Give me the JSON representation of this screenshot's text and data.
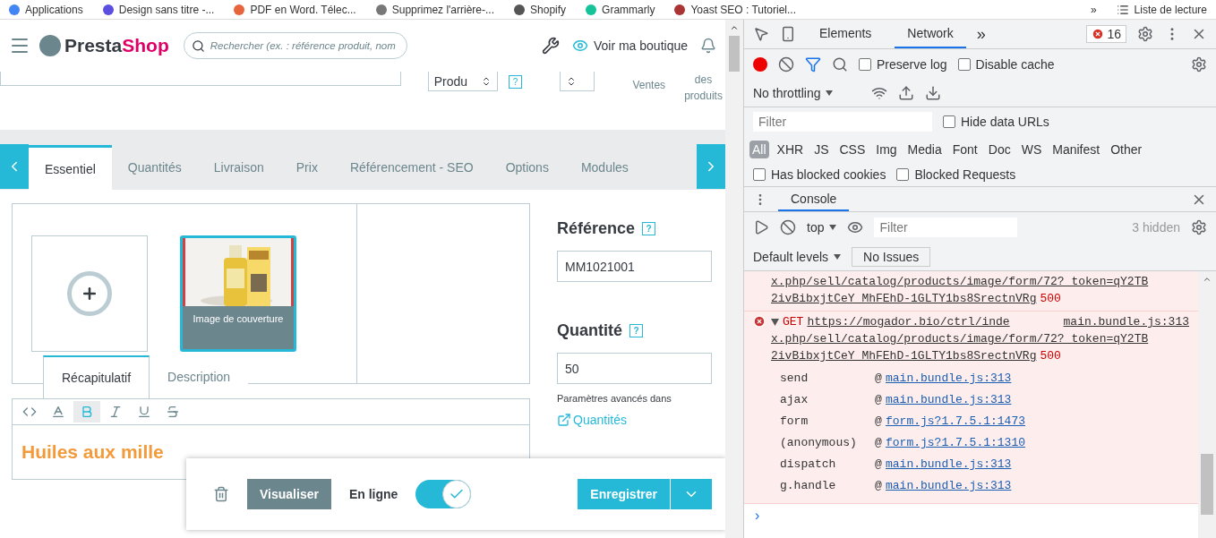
{
  "bookmarks": [
    {
      "label": "Applications"
    },
    {
      "label": "Design sans titre -..."
    },
    {
      "label": "PDF en Word. Télec..."
    },
    {
      "label": "Supprimez l'arrière-..."
    },
    {
      "label": "Shopify"
    },
    {
      "label": "Grammarly"
    },
    {
      "label": "Yoast SEO : Tutoriel..."
    }
  ],
  "bookmarks_more": "»",
  "reading_list": "Liste de lecture",
  "header": {
    "logo_a": "Presta",
    "logo_b": "Shop",
    "search_placeholder": "Rechercher (ex. : référence produit, nom",
    "view_shop": "Voir ma boutique"
  },
  "product_bar": {
    "type_select": "Produ",
    "help": "?",
    "ventes": "Ventes",
    "products_list": "des produits"
  },
  "tabs": [
    {
      "label": "Essentiel",
      "selected": true
    },
    {
      "label": "Quantités",
      "selected": false
    },
    {
      "label": "Livraison",
      "selected": false
    },
    {
      "label": "Prix",
      "selected": false
    },
    {
      "label": "Référencement - SEO",
      "selected": false
    },
    {
      "label": "Options",
      "selected": false
    },
    {
      "label": "Modules",
      "selected": false
    }
  ],
  "images": {
    "cover_caption": "Image de couverture"
  },
  "reference": {
    "label": "Référence",
    "help": "?",
    "value": "MM1021001"
  },
  "quantity": {
    "label": "Quantité",
    "help": "?",
    "value": "50",
    "hint": "Paramètres avancés dans",
    "link": "Quantités"
  },
  "editor_tabs": [
    {
      "label": "Récapitulatif",
      "selected": true
    },
    {
      "label": "Description",
      "selected": false
    }
  ],
  "editor_tools": [
    {
      "kind": "code",
      "selected": false
    },
    {
      "kind": "color",
      "selected": false
    },
    {
      "kind": "bold",
      "selected": true
    },
    {
      "kind": "italic",
      "selected": false
    },
    {
      "kind": "underline",
      "selected": false
    },
    {
      "kind": "strike",
      "selected": false
    }
  ],
  "editor_text": "Huiles aux mille",
  "footer": {
    "preview": "Visualiser",
    "online_label": "En ligne",
    "online": true,
    "save": "Enregistrer"
  },
  "devtools": {
    "tabs": [
      {
        "label": "Elements",
        "selected": false
      },
      {
        "label": "Network",
        "selected": true
      }
    ],
    "more": "»",
    "error_count": "16",
    "checks_top": [
      {
        "label": "Preserve log",
        "checked": false
      },
      {
        "label": "Disable cache",
        "checked": false
      }
    ],
    "throttling": "No throttling",
    "filter_placeholder": "Filter",
    "hide_data_urls": {
      "label": "Hide data URLs",
      "checked": false
    },
    "types": [
      {
        "label": "All",
        "selected": true
      },
      {
        "label": "XHR",
        "selected": false
      },
      {
        "label": "JS",
        "selected": false
      },
      {
        "label": "CSS",
        "selected": false
      },
      {
        "label": "Img",
        "selected": false
      },
      {
        "label": "Media",
        "selected": false
      },
      {
        "label": "Font",
        "selected": false
      },
      {
        "label": "Doc",
        "selected": false
      },
      {
        "label": "WS",
        "selected": false
      },
      {
        "label": "Manifest",
        "selected": false
      },
      {
        "label": "Other",
        "selected": false
      }
    ],
    "checks_blocked": [
      {
        "label": "Has blocked cookies",
        "checked": false
      },
      {
        "label": "Blocked Requests",
        "checked": false
      }
    ],
    "drawer_tab": "Console",
    "context": "top",
    "console_filter_placeholder": "Filter",
    "hidden": "3 hidden",
    "levels": "Default levels",
    "issues": "No Issues",
    "messages": [
      {
        "url_lines": [
          "x.php/sell/catalog/products/image/form/72?_token=qY2TB",
          "2ivBibxjtCeY_MhFEhD-1GLTY1bs8SrectnVRg"
        ],
        "status": "500"
      },
      {
        "expanded": true,
        "method": "GET",
        "url_lines": [
          "https://mogador.bio/ctrl/inde",
          "x.php/sell/catalog/products/image/form/72?_token=qY2TB",
          "2ivBibxjtCeY_MhFEhD-1GLTY1bs8SrectnVRg"
        ],
        "source": "main.bundle.js:313",
        "status": "500",
        "stack": [
          {
            "fn": "send",
            "at": "@",
            "link": "main.bundle.js:313"
          },
          {
            "fn": "ajax",
            "at": "@",
            "link": "main.bundle.js:313"
          },
          {
            "fn": "form",
            "at": "@",
            "link": "form.js?1.7.5.1:1473"
          },
          {
            "fn": "(anonymous)",
            "at": "@",
            "link": "form.js?1.7.5.1:1310"
          },
          {
            "fn": "dispatch",
            "at": "@",
            "link": "main.bundle.js:313"
          },
          {
            "fn": "g.handle",
            "at": "@",
            "link": "main.bundle.js:313"
          }
        ]
      }
    ],
    "prompt": "›"
  }
}
